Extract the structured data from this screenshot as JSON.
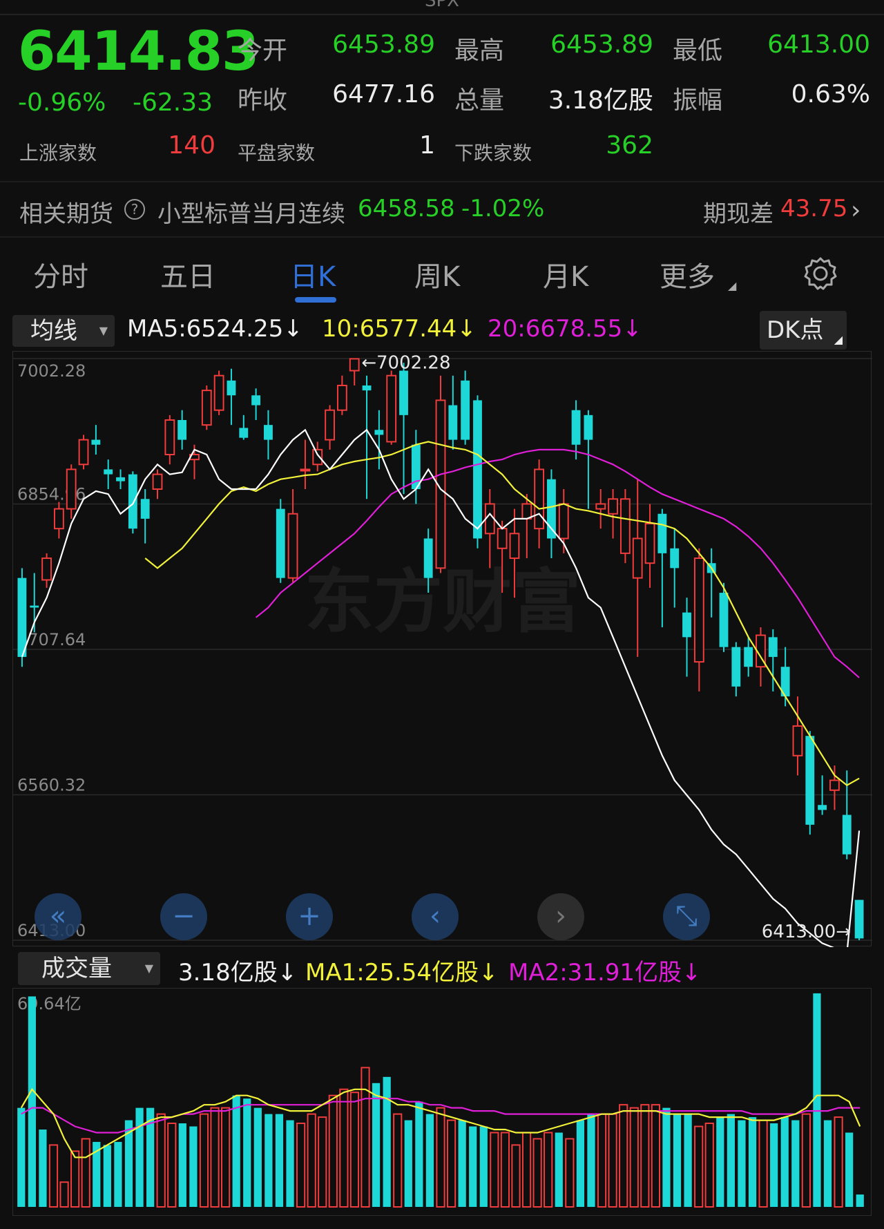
{
  "header": {
    "symbol": "SPX",
    "price": "6414.83",
    "change_pct": "-0.96%",
    "change": "-62.33",
    "stats": [
      {
        "label": "今开",
        "value": "6453.89",
        "color": "green"
      },
      {
        "label": "最高",
        "value": "6453.89",
        "color": "green"
      },
      {
        "label": "最低",
        "value": "6413.00",
        "color": "green"
      },
      {
        "label": "昨收",
        "value": "6477.16",
        "color": "white"
      },
      {
        "label": "总量",
        "value": "3.18亿股",
        "color": "white"
      },
      {
        "label": "振幅",
        "value": "0.63%",
        "color": "white"
      }
    ],
    "breadth": [
      {
        "label": "上涨家数",
        "value": "140",
        "color": "red"
      },
      {
        "label": "平盘家数",
        "value": "1",
        "color": "white"
      },
      {
        "label": "下跌家数",
        "value": "362",
        "color": "green"
      }
    ]
  },
  "futures": {
    "label": "相关期货",
    "help_icon": "question-circle-icon",
    "name": "小型标普当月连续",
    "price": "6458.58",
    "pct": "-1.02%",
    "basis_label": "期现差",
    "basis": "43.75",
    "arrow_icon": "chevron-right-icon"
  },
  "tabs": [
    {
      "label": "分时",
      "active": false
    },
    {
      "label": "五日",
      "active": false
    },
    {
      "label": "日K",
      "active": true
    },
    {
      "label": "周K",
      "active": false
    },
    {
      "label": "月K",
      "active": false
    },
    {
      "label": "更多",
      "active": false
    }
  ],
  "settings_icon": "gear-icon",
  "ma_bar": {
    "select": "均线",
    "ma5": "MA5:6524.25",
    "ma10": "10:6577.44",
    "ma20": "20:6678.55",
    "down_arrow": "↓",
    "dk_button": "DK点"
  },
  "volume_bar": {
    "select": "成交量",
    "vol": "3.18亿股",
    "ma1": "MA1:25.54亿股",
    "ma2": "MA2:31.91亿股",
    "down_arrow": "↓"
  },
  "watermark": "东方财富",
  "colors": {
    "up": "#f03c3c",
    "down": "#1ed8d8",
    "ma5": "#ffffff",
    "ma10": "#f2f23a",
    "ma20": "#e01fd8",
    "accent": "#2f6fd6"
  },
  "nav_icons": [
    "double-left-icon",
    "zoom-out-icon",
    "zoom-in-icon",
    "left-icon",
    "right-icon",
    "expand-icon"
  ],
  "chart_data": {
    "type": "candlestick",
    "yticks": [
      "7002.28",
      "6854.96",
      "6707.64",
      "6560.32",
      "6413.00"
    ],
    "ylim": [
      6413.0,
      7002.28
    ],
    "high_label": "7002.28",
    "low_label": "6413.00",
    "candles": [
      {
        "o": 6780,
        "c": 6700,
        "h": 6790,
        "l": 6690
      },
      {
        "o": 6752,
        "c": 6750,
        "h": 6785,
        "l": 6725
      },
      {
        "o": 6778,
        "c": 6800,
        "h": 6805,
        "l": 6770
      },
      {
        "o": 6830,
        "c": 6850,
        "h": 6857,
        "l": 6820
      },
      {
        "o": 6850,
        "c": 6890,
        "h": 6895,
        "l": 6840
      },
      {
        "o": 6895,
        "c": 6920,
        "h": 6925,
        "l": 6890
      },
      {
        "o": 6920,
        "c": 6915,
        "h": 6935,
        "l": 6905
      },
      {
        "o": 6890,
        "c": 6885,
        "h": 6900,
        "l": 6870
      },
      {
        "o": 6882,
        "c": 6878,
        "h": 6890,
        "l": 6870
      },
      {
        "o": 6885,
        "c": 6830,
        "h": 6888,
        "l": 6825
      },
      {
        "o": 6860,
        "c": 6840,
        "h": 6870,
        "l": 6815
      },
      {
        "o": 6870,
        "c": 6885,
        "h": 6890,
        "l": 6860
      },
      {
        "o": 6905,
        "c": 6940,
        "h": 6945,
        "l": 6895
      },
      {
        "o": 6940,
        "c": 6920,
        "h": 6950,
        "l": 6910
      },
      {
        "o": 6900,
        "c": 6905,
        "h": 6915,
        "l": 6880
      },
      {
        "o": 6935,
        "c": 6970,
        "h": 6975,
        "l": 6930
      },
      {
        "o": 6950,
        "c": 6985,
        "h": 6990,
        "l": 6945
      },
      {
        "o": 6980,
        "c": 6965,
        "h": 6992,
        "l": 6935
      },
      {
        "o": 6932,
        "c": 6922,
        "h": 6945,
        "l": 6920
      },
      {
        "o": 6965,
        "c": 6955,
        "h": 6972,
        "l": 6940
      },
      {
        "o": 6935,
        "c": 6920,
        "h": 6950,
        "l": 6900
      },
      {
        "o": 6850,
        "c": 6780,
        "h": 6860,
        "l": 6775
      },
      {
        "o": 6780,
        "c": 6845,
        "h": 6870,
        "l": 6775
      },
      {
        "o": 6890,
        "c": 6890,
        "h": 6920,
        "l": 6870
      },
      {
        "o": 6895,
        "c": 6910,
        "h": 6918,
        "l": 6888
      },
      {
        "o": 6920,
        "c": 6950,
        "h": 6955,
        "l": 6910
      },
      {
        "o": 6950,
        "c": 6975,
        "h": 6985,
        "l": 6945
      },
      {
        "o": 6990,
        "c": 7002,
        "h": 7002,
        "l": 6975
      },
      {
        "o": 6975,
        "c": 6970,
        "h": 6985,
        "l": 6860
      },
      {
        "o": 6930,
        "c": 6925,
        "h": 6950,
        "l": 6890
      },
      {
        "o": 6918,
        "c": 6985,
        "h": 6990,
        "l": 6915
      },
      {
        "o": 6990,
        "c": 6945,
        "h": 6998,
        "l": 6865
      },
      {
        "o": 6915,
        "c": 6870,
        "h": 6930,
        "l": 6855
      },
      {
        "o": 6820,
        "c": 6780,
        "h": 6830,
        "l": 6765
      },
      {
        "o": 6790,
        "c": 6960,
        "h": 6985,
        "l": 6785
      },
      {
        "o": 6955,
        "c": 6920,
        "h": 6985,
        "l": 6910
      },
      {
        "o": 6980,
        "c": 6920,
        "h": 6990,
        "l": 6915
      },
      {
        "o": 6960,
        "c": 6820,
        "h": 6965,
        "l": 6810
      },
      {
        "o": 6825,
        "c": 6855,
        "h": 6870,
        "l": 6790
      },
      {
        "o": 6810,
        "c": 6830,
        "h": 6838,
        "l": 6765
      },
      {
        "o": 6800,
        "c": 6825,
        "h": 6850,
        "l": 6760
      },
      {
        "o": 6840,
        "c": 6855,
        "h": 6865,
        "l": 6800
      },
      {
        "o": 6830,
        "c": 6890,
        "h": 6900,
        "l": 6810
      },
      {
        "o": 6880,
        "c": 6820,
        "h": 6890,
        "l": 6800
      },
      {
        "o": 6820,
        "c": 6855,
        "h": 6870,
        "l": 6805
      },
      {
        "o": 6950,
        "c": 6915,
        "h": 6960,
        "l": 6900
      },
      {
        "o": 6945,
        "c": 6920,
        "h": 6950,
        "l": 6850
      },
      {
        "o": 6850,
        "c": 6855,
        "h": 6870,
        "l": 6830
      },
      {
        "o": 6845,
        "c": 6860,
        "h": 6870,
        "l": 6820
      },
      {
        "o": 6805,
        "c": 6860,
        "h": 6870,
        "l": 6795
      },
      {
        "o": 6780,
        "c": 6820,
        "h": 6880,
        "l": 6700
      },
      {
        "o": 6795,
        "c": 6835,
        "h": 6855,
        "l": 6770
      },
      {
        "o": 6845,
        "c": 6805,
        "h": 6850,
        "l": 6730
      },
      {
        "o": 6810,
        "c": 6790,
        "h": 6830,
        "l": 6750
      },
      {
        "o": 6745,
        "c": 6720,
        "h": 6760,
        "l": 6680
      },
      {
        "o": 6695,
        "c": 6800,
        "h": 6810,
        "l": 6665
      },
      {
        "o": 6795,
        "c": 6785,
        "h": 6810,
        "l": 6740
      },
      {
        "o": 6765,
        "c": 6710,
        "h": 6775,
        "l": 6705
      },
      {
        "o": 6710,
        "c": 6670,
        "h": 6715,
        "l": 6660
      },
      {
        "o": 6710,
        "c": 6690,
        "h": 6720,
        "l": 6680
      },
      {
        "o": 6690,
        "c": 6722,
        "h": 6730,
        "l": 6670
      },
      {
        "o": 6720,
        "c": 6700,
        "h": 6728,
        "l": 6665
      },
      {
        "o": 6690,
        "c": 6660,
        "h": 6710,
        "l": 6650
      },
      {
        "o": 6600,
        "c": 6630,
        "h": 6660,
        "l": 6580
      },
      {
        "o": 6620,
        "c": 6530,
        "h": 6625,
        "l": 6520
      },
      {
        "o": 6550,
        "c": 6545,
        "h": 6580,
        "l": 6540
      },
      {
        "o": 6565,
        "c": 6575,
        "h": 6590,
        "l": 6545
      },
      {
        "o": 6540,
        "c": 6500,
        "h": 6585,
        "l": 6495
      },
      {
        "o": 6453.89,
        "c": 6414.83,
        "h": 6453.89,
        "l": 6413.0
      }
    ],
    "ma5": [
      6700,
      6735,
      6760,
      6795,
      6835,
      6860,
      6868,
      6865,
      6845,
      6855,
      6880,
      6895,
      6885,
      6887,
      6910,
      6905,
      6880,
      6870,
      6870,
      6870,
      6885,
      6905,
      6920,
      6930,
      6905,
      6890,
      6905,
      6920,
      6930,
      6910,
      6880,
      6860,
      6870,
      6890,
      6870,
      6860,
      6840,
      6830,
      6845,
      6830,
      6840,
      6840,
      6845,
      6830,
      6815,
      6790,
      6760,
      6750,
      6720,
      6690,
      6660,
      6630,
      6600,
      6575,
      6560,
      6545,
      6525,
      6510,
      6500,
      6485,
      6470,
      6455,
      6445,
      6430,
      6420,
      6410,
      6405,
      6400,
      6524
    ],
    "ma10": [
      6800,
      6790,
      6800,
      6810,
      6825,
      6840,
      6855,
      6868,
      6872,
      6868,
      6875,
      6880,
      6882,
      6884,
      6885,
      6890,
      6895,
      6898,
      6900,
      6902,
      6905,
      6910,
      6915,
      6918,
      6915,
      6912,
      6910,
      6905,
      6895,
      6885,
      6870,
      6860,
      6850,
      6852,
      6855,
      6850,
      6848,
      6845,
      6842,
      6840,
      6838,
      6836,
      6834,
      6830,
      6820,
      6805,
      6790,
      6770,
      6745,
      6720,
      6700,
      6680,
      6660,
      6640,
      6620,
      6600,
      6580,
      6570,
      6577
    ],
    "ma20": [
      6740,
      6750,
      6765,
      6775,
      6785,
      6795,
      6805,
      6815,
      6825,
      6838,
      6852,
      6865,
      6872,
      6878,
      6880,
      6885,
      6888,
      6892,
      6895,
      6898,
      6900,
      6905,
      6908,
      6910,
      6910,
      6910,
      6908,
      6905,
      6900,
      6895,
      6888,
      6880,
      6872,
      6865,
      6860,
      6855,
      6850,
      6845,
      6840,
      6832,
      6822,
      6810,
      6795,
      6778,
      6760,
      6740,
      6720,
      6700,
      6690,
      6679
    ],
    "volume": {
      "ylabel": "69.64亿",
      "max": 69.64,
      "values": [
        32,
        68,
        25,
        20,
        8,
        18,
        22,
        21,
        20,
        21,
        28,
        32,
        32,
        30,
        27,
        27,
        26,
        30,
        32,
        32,
        36,
        35,
        32,
        30,
        30,
        28,
        27,
        30,
        29,
        36,
        38,
        37,
        45,
        40,
        42,
        30,
        28,
        34,
        30,
        32,
        28,
        28,
        26,
        26,
        24,
        24,
        20,
        24,
        22,
        24,
        24,
        22,
        28,
        30,
        30,
        30,
        33,
        32,
        33,
        33,
        32,
        30,
        30,
        26,
        27,
        29,
        30,
        28,
        29,
        28,
        27,
        29,
        28,
        30,
        69,
        28,
        29,
        24,
        4
      ],
      "ma1": [
        32,
        38,
        34,
        30,
        22,
        16,
        16,
        18,
        20,
        22,
        24,
        26,
        28,
        29,
        29,
        30,
        31,
        33,
        33,
        34,
        36,
        36,
        35,
        33,
        32,
        31,
        31,
        31,
        33,
        35,
        37,
        38,
        38,
        36,
        35,
        33,
        33,
        32,
        31,
        30,
        29,
        28,
        27,
        26,
        25,
        25,
        24,
        24,
        24,
        25,
        26,
        27,
        28,
        29,
        30,
        30,
        31,
        31,
        31,
        31,
        30,
        30,
        30,
        30,
        29,
        29,
        29,
        29,
        28,
        28,
        28,
        29,
        30,
        32,
        36,
        36,
        36,
        34,
        26
      ],
      "ma2": [
        30,
        32,
        32,
        30,
        28,
        26,
        25,
        24,
        24,
        24,
        25,
        26,
        27,
        28,
        29,
        30,
        30,
        31,
        31,
        31,
        32,
        33,
        33,
        33,
        33,
        33,
        33,
        33,
        33,
        34,
        34,
        34,
        35,
        35,
        35,
        35,
        34,
        34,
        33,
        33,
        32,
        32,
        31,
        31,
        31,
        30,
        30,
        30,
        30,
        30,
        30,
        30,
        30,
        30,
        30,
        30,
        31,
        31,
        31,
        31,
        31,
        31,
        31,
        31,
        31,
        31,
        31,
        31,
        30,
        30,
        30,
        30,
        30,
        31,
        31,
        31,
        32,
        32,
        32
      ]
    }
  }
}
